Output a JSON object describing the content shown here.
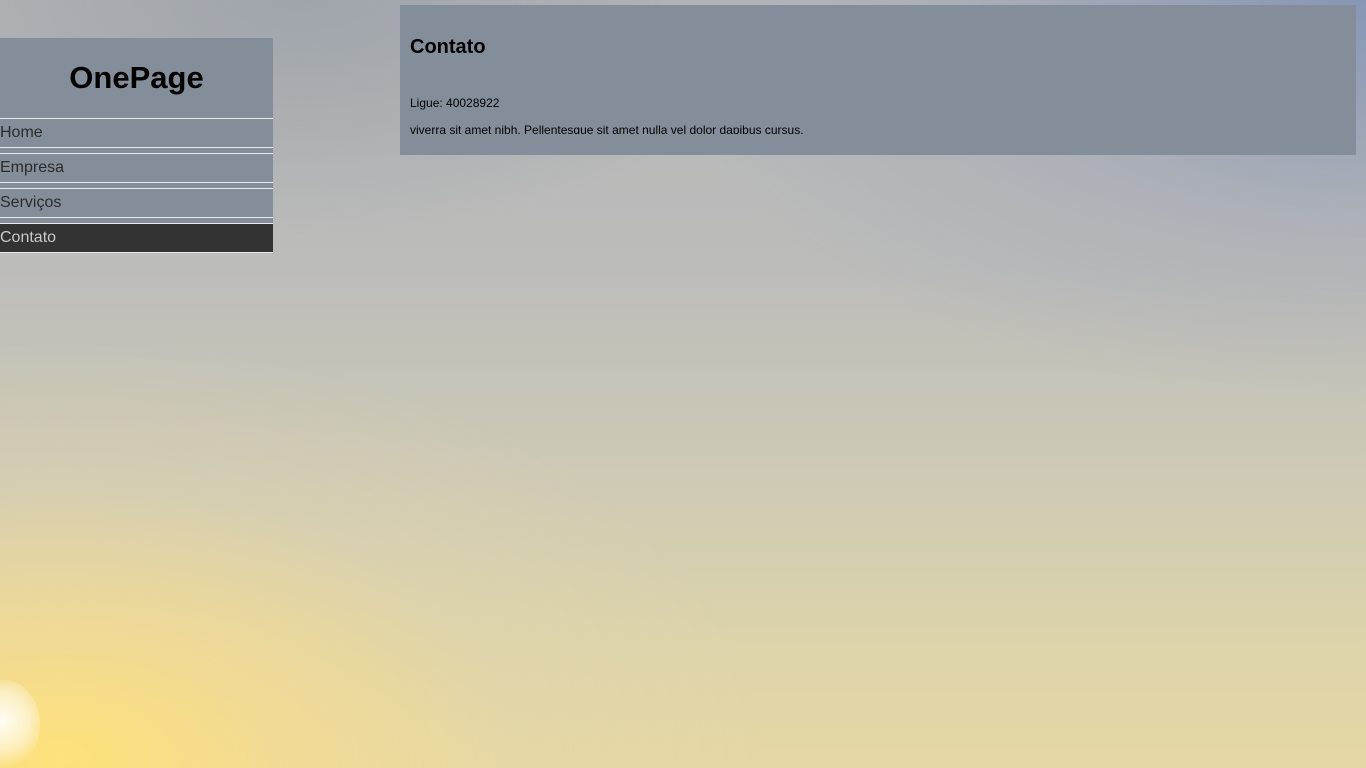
{
  "sidebar": {
    "brand": "OnePage",
    "items": [
      {
        "label": "Home",
        "active": false
      },
      {
        "label": "Empresa",
        "active": false
      },
      {
        "label": "Serviços",
        "active": false
      },
      {
        "label": "Contato",
        "active": true
      }
    ]
  },
  "content": {
    "title": "Contato",
    "phone": "Ligue: 40028922",
    "clipped_text": "viverra sit amet nibh. Pellentesque sit amet nulla vel dolor dapibus cursus."
  },
  "colors": {
    "panel_bg": "#848e9b",
    "active_item_bg": "#333333"
  }
}
